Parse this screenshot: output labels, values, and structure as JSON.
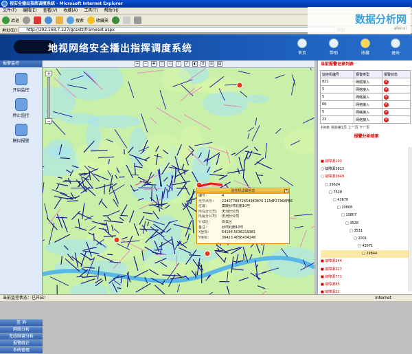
{
  "window": {
    "title": "视安全播出指挥调度系统 - Microsoft Internet Explorer"
  },
  "menu": [
    "文件(F)",
    "编辑(E)",
    "查看(V)",
    "收藏(A)",
    "工具(T)",
    "帮助(H)"
  ],
  "toolbar": {
    "back": "后退",
    "search": "搜索",
    "favorites": "收藏夹"
  },
  "address": {
    "label": "地址(D)",
    "url": "http://192.168.7.127/gcsxtz/frameset.aspx",
    "go": "转到"
  },
  "watermark": {
    "brand": "数据分析网",
    "sub": "afenxi"
  },
  "banner": {
    "title": "地视网络安全播出指挥调度系统",
    "icons": [
      {
        "label": "首页"
      },
      {
        "label": "帮助"
      },
      {
        "label": "收藏"
      },
      {
        "label": "退出"
      }
    ]
  },
  "left": {
    "header": "报警监控",
    "items": [
      "开启监控",
      "停止监控",
      "模拟报警"
    ],
    "bottom": [
      "查 询",
      "网络分析",
      "无线频谱分析",
      "报警统计",
      "系统管理"
    ]
  },
  "map": {
    "popup": {
      "title": "监控机详细信息",
      "rows": [
        {
          "k": "编号：",
          "v": "4"
        },
        {
          "k": "光节点号：",
          "v": "2240778972654980876 1154F2736AFE6"
        },
        {
          "k": "位置：",
          "v": "莫陂纱湾北南10号"
        },
        {
          "k": "所在分公司：",
          "v": "天河分公司"
        },
        {
          "k": "所属分公司：",
          "v": "天河分公司"
        },
        {
          "k": "行政区：",
          "v": "白云区"
        },
        {
          "k": "备注：",
          "v": "纱湾北南10号"
        },
        {
          "k": "X坐标：",
          "v": "54194.5036219381"
        },
        {
          "k": "Y坐标：",
          "v": "36423.4056434248"
        }
      ]
    }
  },
  "right": {
    "alarm_header": "当前报警记录列表",
    "columns": [
      "监控机编号",
      "报警类型",
      "报警状态"
    ],
    "rows": [
      {
        "id": "821",
        "type": "网络接入"
      },
      {
        "id": "5",
        "type": "网络接入"
      },
      {
        "id": "5",
        "type": "网络接入"
      },
      {
        "id": "66",
        "type": "网络接入"
      },
      {
        "id": "5",
        "type": "网络接入"
      },
      {
        "id": "23",
        "type": "网络接入"
      }
    ],
    "pager": "共6条 当前第1页   上一页 下一页",
    "analysis_header": "报警分析结果",
    "tree": [
      {
        "t": "■ 故障源193",
        "indent": 0,
        "red": true
      },
      {
        "t": "□ 故障源3613",
        "indent": 0,
        "red": false
      },
      {
        "t": "□ 故障源3649",
        "indent": 0,
        "red": true
      },
      {
        "t": "□ 29624",
        "indent": 6,
        "red": false
      },
      {
        "t": "□ 7528",
        "indent": 12,
        "red": false
      },
      {
        "t": "□ 43670",
        "indent": 18,
        "red": false
      },
      {
        "t": "□ 10808",
        "indent": 24,
        "red": false
      },
      {
        "t": "□ 10807",
        "indent": 30,
        "red": false
      },
      {
        "t": "□ 3528",
        "indent": 36,
        "red": false
      },
      {
        "t": "□ 3531",
        "indent": 42,
        "red": false
      },
      {
        "t": "□ 2001",
        "indent": 48,
        "red": false
      },
      {
        "t": "□ 43671",
        "indent": 54,
        "red": false
      },
      {
        "t": "□ 29844",
        "indent": 60,
        "red": false,
        "sel": true
      },
      {
        "t": "■ 故障源344",
        "indent": 0,
        "red": true
      },
      {
        "t": "■ 故障源327",
        "indent": 0,
        "red": true
      },
      {
        "t": "■ 故障源771",
        "indent": 0,
        "red": true
      },
      {
        "t": "■ 故障源85",
        "indent": 0,
        "red": true
      },
      {
        "t": "■ 故障源22",
        "indent": 0,
        "red": true
      },
      {
        "t": "■ 故障源775",
        "indent": 0,
        "red": true
      }
    ]
  },
  "status": {
    "left": "当前监控状态：已开启！",
    "zone": "Internet"
  },
  "colors": {
    "accent": "#2d5ca6",
    "alarm": "#cc0000",
    "map_bg": "#c9f0a8"
  }
}
